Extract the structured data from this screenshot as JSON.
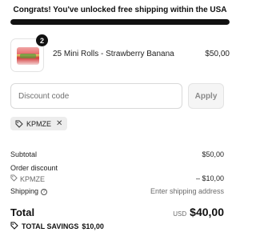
{
  "banner": {
    "text": "Congrats! You've unlocked free shipping within the USA"
  },
  "progress": {
    "fraction": 1.0,
    "color": "#111111"
  },
  "cart": {
    "items": [
      {
        "quantity": "2",
        "name": "25 Mini Rolls - Strawberry Banana",
        "price": "$50,00"
      }
    ]
  },
  "discount": {
    "placeholder": "Discount code",
    "value": "",
    "apply_label": "Apply",
    "applied_code": "KPMZE",
    "remove_glyph": "✕"
  },
  "summary": {
    "subtotal_label": "Subtotal",
    "subtotal_value": "$50,00",
    "order_discount_label": "Order discount",
    "discount_code": "KPMZE",
    "discount_value": "– $10,00",
    "shipping_label": "Shipping",
    "shipping_info_glyph": "?",
    "shipping_value": "Enter shipping address",
    "total_label": "Total",
    "total_currency": "USD",
    "total_value": "$40,00",
    "savings_label": "TOTAL SAVINGS",
    "savings_value": "$10,00"
  },
  "icons": {
    "tag": "tag-icon",
    "info": "info-icon",
    "close": "close-icon"
  }
}
